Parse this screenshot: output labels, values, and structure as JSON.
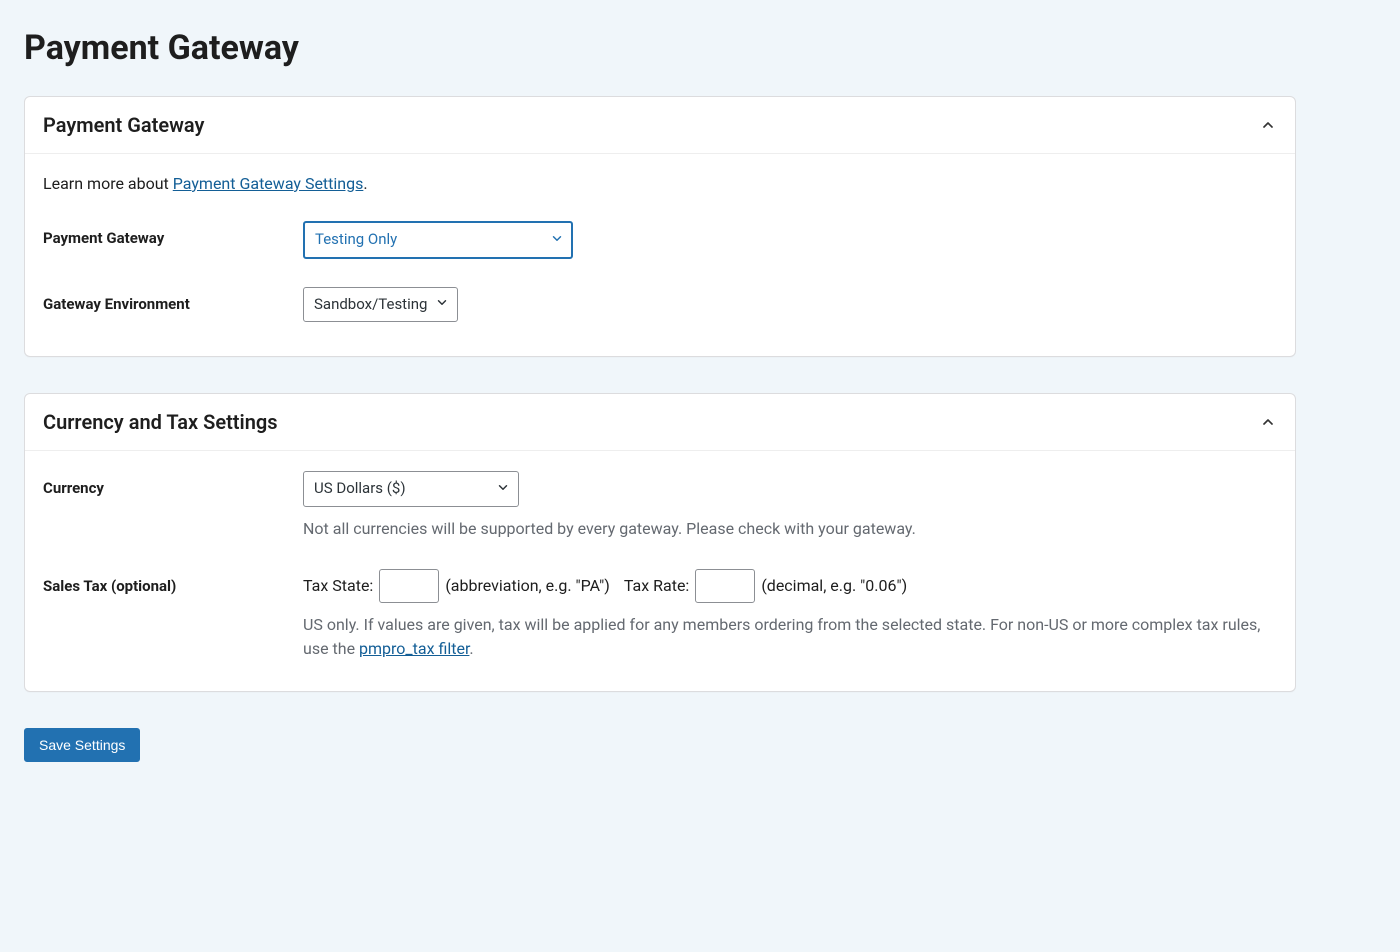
{
  "page": {
    "title": "Payment Gateway"
  },
  "sections": {
    "gateway": {
      "heading": "Payment Gateway",
      "intro_prefix": "Learn more about ",
      "intro_link": "Payment Gateway Settings",
      "intro_suffix": ".",
      "fields": {
        "gateway": {
          "label": "Payment Gateway",
          "value": "Testing Only"
        },
        "environment": {
          "label": "Gateway Environment",
          "value": "Sandbox/Testing"
        }
      }
    },
    "currency": {
      "heading": "Currency and Tax Settings",
      "fields": {
        "currency": {
          "label": "Currency",
          "value": "US Dollars ($)",
          "hint": "Not all currencies will be supported by every gateway. Please check with your gateway."
        },
        "sales_tax": {
          "label": "Sales Tax (optional)",
          "tax_state_label": "Tax State:",
          "tax_state_hint": "(abbreviation, e.g. \"PA\")",
          "tax_rate_label": "Tax Rate:",
          "tax_rate_hint": "(decimal, e.g. \"0.06\")",
          "hint_prefix": "US only. If values are given, tax will be applied for any members ordering from the selected state. For non-US or more complex tax rules, use the ",
          "hint_link": "pmpro_tax filter",
          "hint_suffix": "."
        }
      }
    }
  },
  "actions": {
    "save": "Save Settings"
  }
}
